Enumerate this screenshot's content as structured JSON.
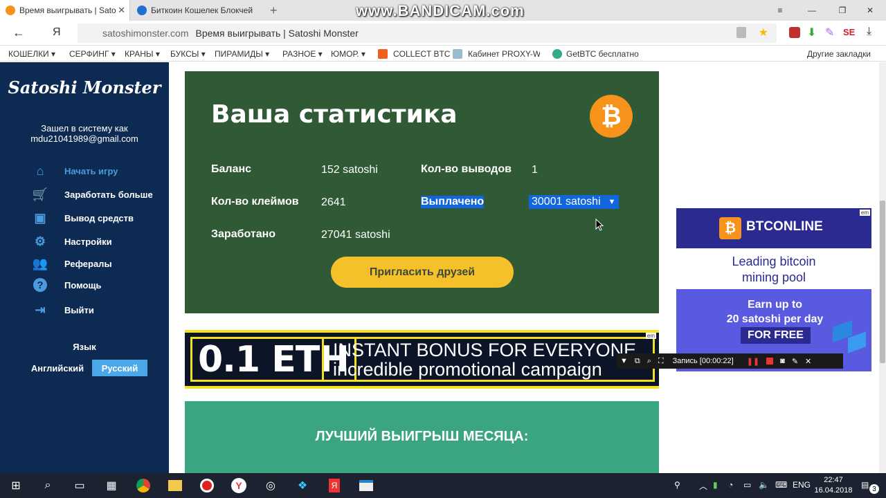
{
  "browser": {
    "tabs": [
      {
        "title": "Время выигрывать | Sato",
        "active": true
      },
      {
        "title": "Биткоин Кошелек Блокчей",
        "active": false
      }
    ],
    "new_tab": "+",
    "watermark": "www.BANDICAM.com",
    "window_controls": [
      "≡",
      "—",
      "❐",
      "✕"
    ],
    "back": "←",
    "yandex_glyph": "Я",
    "url_host": "satoshimonster.com",
    "url_title": "Время выигрывать | Satoshi Monster",
    "download_glyph": "⤓",
    "bookmarks": [
      "КОШЕЛКИ ▾",
      "СЕРФИНГ ▾",
      "КРАНЫ ▾",
      "БУКСЫ ▾",
      "ПИРАМИДЫ ▾",
      "РАЗНОЕ ▾",
      "ЮМОР. ▾",
      "COLLECT BTC",
      "Кабинет PROXY-W",
      "GetBTC бесплатно"
    ],
    "other_bookmarks": "Другие закладки"
  },
  "sidebar": {
    "logo": "Satoshi Monster",
    "login_line1": "Зашел в систему как",
    "login_email": "mdu21041989@gmail.com",
    "nav": [
      {
        "label": "Начать игру",
        "icon": "home-icon",
        "glyph": "⌂",
        "active": true
      },
      {
        "label": "Заработать больше",
        "icon": "cart-icon",
        "glyph": "🛒",
        "active": false
      },
      {
        "label": "Вывод средств",
        "icon": "wallet-icon",
        "glyph": "▣",
        "active": false
      },
      {
        "label": "Настройки",
        "icon": "gear-icon",
        "glyph": "⚙",
        "active": false
      },
      {
        "label": "Рефералы",
        "icon": "people-icon",
        "glyph": "👥",
        "active": false
      },
      {
        "label": "Помощь",
        "icon": "help-icon",
        "glyph": "?",
        "active": false
      },
      {
        "label": "Выйти",
        "icon": "logout-icon",
        "glyph": "⇥",
        "active": false
      }
    ],
    "language_title": "Язык",
    "languages": [
      {
        "label": "Английский",
        "selected": false
      },
      {
        "label": "Русский",
        "selected": true
      }
    ]
  },
  "stats": {
    "title": "Ваша статистика",
    "btc_glyph": "₿",
    "balance_label": "Баланс",
    "balance_value": "152 satoshi",
    "claims_label": "Кол-во клеймов",
    "claims_value": "2641",
    "earned_label": "Заработано",
    "earned_value": "27041 satoshi",
    "withdrawals_label": "Кол-во выводов",
    "withdrawals_value": "1",
    "paid_label": "Выплачено",
    "paid_value": "30001 satoshi",
    "invite_button": "Пригласить друзей"
  },
  "eth_banner": {
    "big": "0.1 ETH",
    "line1": "INSTANT BONUS FOR EVERYONE",
    "line2": "incredible promotional campaign",
    "badge": "em"
  },
  "monthly": {
    "title": "ЛУЧШИЙ ВЫИГРЫШ МЕСЯЦА:"
  },
  "ad": {
    "brand": "BTCONLINE",
    "tag_line1": "Leading bitcoin",
    "tag_line2": "mining pool",
    "earn_line1": "Earn up to",
    "earn_line2": "20 satoshi per day",
    "free": "FOR FREE",
    "badge": "em"
  },
  "recorder": {
    "label": "Запись [00:00:22]"
  },
  "taskbar": {
    "lang": "ENG",
    "time": "22:47",
    "date": "16.04.2018",
    "notif_count": "3"
  }
}
